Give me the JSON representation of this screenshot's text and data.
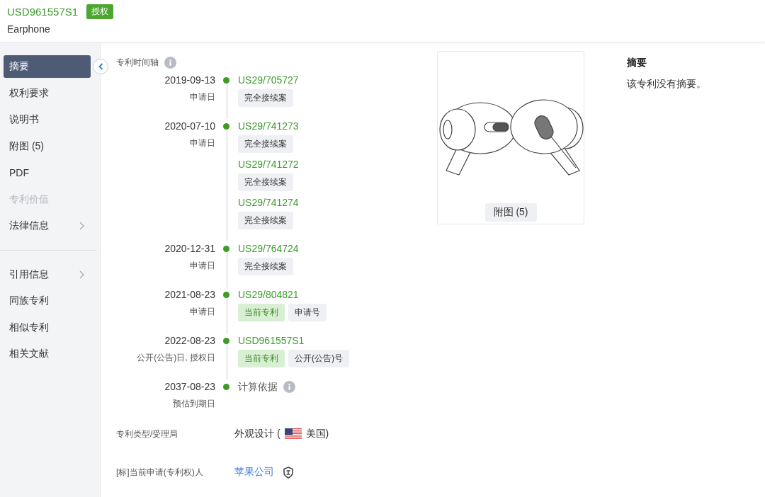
{
  "header": {
    "patent_number": "USD961557S1",
    "status_badge": "授权",
    "title": "Earphone"
  },
  "sidebar": {
    "groups": [
      {
        "items": [
          {
            "label": "摘要",
            "selected": true,
            "disabled": false,
            "submenu": false
          },
          {
            "label": "权利要求",
            "selected": false,
            "disabled": false,
            "submenu": false
          },
          {
            "label": "说明书",
            "selected": false,
            "disabled": false,
            "submenu": false
          },
          {
            "label": "附图 (5)",
            "selected": false,
            "disabled": false,
            "submenu": false
          },
          {
            "label": "PDF",
            "selected": false,
            "disabled": false,
            "submenu": false
          },
          {
            "label": "专利价值",
            "selected": false,
            "disabled": true,
            "submenu": false
          },
          {
            "label": "法律信息",
            "selected": false,
            "disabled": false,
            "submenu": true
          }
        ]
      },
      {
        "items": [
          {
            "label": "引用信息",
            "selected": false,
            "disabled": false,
            "submenu": true
          },
          {
            "label": "同族专利",
            "selected": false,
            "disabled": false,
            "submenu": false
          },
          {
            "label": "相似专利",
            "selected": false,
            "disabled": false,
            "submenu": false
          },
          {
            "label": "相关文献",
            "selected": false,
            "disabled": false,
            "submenu": false
          }
        ]
      }
    ]
  },
  "timeline": {
    "title": "专利时间轴",
    "entries": [
      {
        "date": "2019-09-13",
        "date_label": "申请日",
        "docs": [
          {
            "number": "US29/705727",
            "tags": [
              {
                "label": "完全接续案",
                "kind": "plain"
              }
            ]
          }
        ]
      },
      {
        "date": "2020-07-10",
        "date_label": "申请日",
        "docs": [
          {
            "number": "US29/741273",
            "tags": [
              {
                "label": "完全接续案",
                "kind": "plain"
              }
            ]
          },
          {
            "number": "US29/741272",
            "tags": [
              {
                "label": "完全接续案",
                "kind": "plain"
              }
            ]
          },
          {
            "number": "US29/741274",
            "tags": [
              {
                "label": "完全接续案",
                "kind": "plain"
              }
            ]
          }
        ]
      },
      {
        "date": "2020-12-31",
        "date_label": "申请日",
        "docs": [
          {
            "number": "US29/764724",
            "tags": [
              {
                "label": "完全接续案",
                "kind": "plain"
              }
            ]
          }
        ]
      },
      {
        "date": "2021-08-23",
        "date_label": "申请日",
        "docs": [
          {
            "number": "US29/804821",
            "tags": [
              {
                "label": "当前专利",
                "kind": "current"
              },
              {
                "label": "申请号",
                "kind": "plain"
              }
            ]
          }
        ]
      },
      {
        "date": "2022-08-23",
        "date_label": "公开(公告)日, 授权日",
        "docs": [
          {
            "number": "USD961557S1",
            "tags": [
              {
                "label": "当前专利",
                "kind": "current"
              },
              {
                "label": "公开(公告)号",
                "kind": "plain"
              }
            ]
          }
        ]
      },
      {
        "date": "2037-08-23",
        "date_label": "预估到期日",
        "note": "计算依据"
      }
    ]
  },
  "fields": [
    {
      "kind": "office",
      "label": "专利类型/受理局",
      "prefix": "外观设计 (",
      "suffix": "美国)"
    },
    {
      "kind": "link",
      "label": "[标]当前申请(专利权)人",
      "value": "苹果公司"
    }
  ],
  "figure": {
    "caption": "附图 (5)"
  },
  "abstract": {
    "title": "摘要",
    "text": "该专利没有摘要。"
  }
}
